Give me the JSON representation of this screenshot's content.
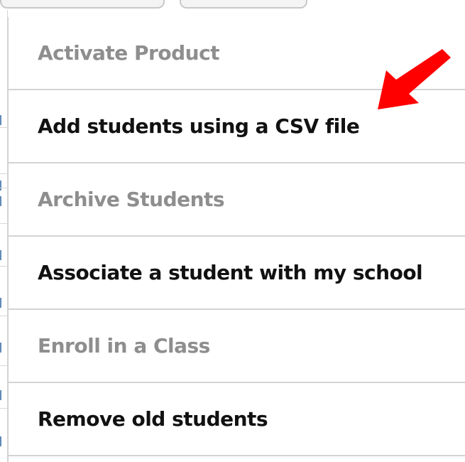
{
  "menu": {
    "items": [
      {
        "label": "Activate Product",
        "enabled": false
      },
      {
        "label": "Add students using a CSV file",
        "enabled": true
      },
      {
        "label": "Archive Students",
        "enabled": false
      },
      {
        "label": "Associate a student with my school",
        "enabled": true
      },
      {
        "label": "Enroll in a Class",
        "enabled": false
      },
      {
        "label": "Remove old students",
        "enabled": true
      }
    ]
  },
  "annotation": {
    "arrow_color": "#ff0000",
    "points_to": "Add students using a CSV file"
  },
  "colors": {
    "enabled_text": "#111111",
    "disabled_text": "#8e8e8e",
    "divider": "#d3d3d3"
  }
}
